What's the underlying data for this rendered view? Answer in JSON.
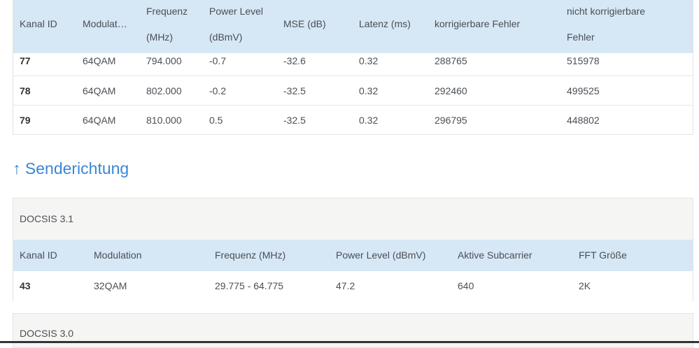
{
  "downstream_table": {
    "headers": [
      "Kanal ID",
      "Modulat…",
      "Frequenz",
      "(MHz)",
      "Power Level",
      "(dBmV)",
      "MSE (dB)",
      "Latenz (ms)",
      "korrigierbare Fehler",
      "nicht korrigierbare",
      "Fehler"
    ],
    "rows": [
      [
        "77",
        "64QAM",
        "794.000",
        "-0.7",
        "-32.6",
        "0.32",
        "288765",
        "515978"
      ],
      [
        "78",
        "64QAM",
        "802.000",
        "-0.2",
        "-32.5",
        "0.32",
        "292460",
        "499525"
      ],
      [
        "79",
        "64QAM",
        "810.000",
        "0.5",
        "-32.5",
        "0.32",
        "296795",
        "448802"
      ]
    ]
  },
  "upstream": {
    "title": "↑ Senderichtung",
    "docsis31": {
      "label": "DOCSIS 3.1",
      "headers": [
        "Kanal ID",
        "Modulation",
        "Frequenz (MHz)",
        "Power Level (dBmV)",
        "Aktive Subcarrier",
        "FFT Größe"
      ],
      "rows": [
        [
          "43",
          "32QAM",
          "29.775 - 64.775",
          "47.2",
          "640",
          "2K"
        ]
      ]
    },
    "docsis30": {
      "label": "DOCSIS 3.0"
    }
  },
  "colors": {
    "header_bg": "#d6e7f5",
    "accent": "#3a86d6",
    "box_bg": "#f5f5f3"
  }
}
